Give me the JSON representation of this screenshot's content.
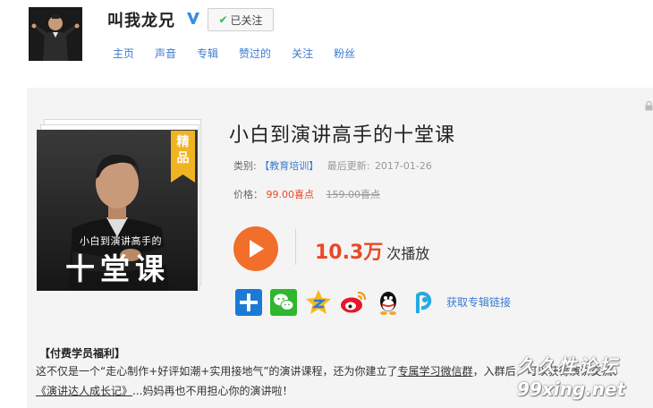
{
  "profile": {
    "username": "叫我龙兄",
    "follow_label": "已关注",
    "verified_icon": "verified-v-icon"
  },
  "nav": {
    "items": [
      "主页",
      "声音",
      "专辑",
      "赞过的",
      "关注",
      "粉丝"
    ]
  },
  "album": {
    "title": "小白到演讲高手的十堂课",
    "category_label": "类别:",
    "category": "【教育培训】",
    "updated_label": "最后更新:",
    "updated": "2017-01-26",
    "price_label": "价格：",
    "price": "99.00喜点",
    "original_price": "159.00喜点",
    "badge": "精品",
    "cover_subtitle": "小白到演讲高手的",
    "cover_title": "十堂课",
    "plays_count": "10.3万",
    "plays_unit": "次播放"
  },
  "share": {
    "icons": [
      "plus-share-icon",
      "wechat-icon",
      "qzone-icon",
      "weibo-icon",
      "qq-icon",
      "pengyou-icon"
    ],
    "link_label": "获取专辑链接"
  },
  "description": {
    "benefit_title": "【付费学员福利】",
    "line1_a": "这不仅是一个“走心制作+好评如潮+实用接地气”的演讲课程，还为你建立了",
    "line1_link": "专属学习微信群",
    "line1_b": "，入群后",
    "line1_c": "，可以",
    "line1_d": "获得",
    "line1_e": "演讲交流、",
    "line2_link": "《演讲达人成长记》",
    "line2_b": "...妈妈再也不用担心你的演讲啦！"
  },
  "watermark": {
    "cn": "久久性论坛",
    "en": "99xing.net"
  },
  "colors": {
    "link": "#3b7bd1",
    "accent": "#e94826",
    "play": "#f26e2b",
    "badge": "#f0b422",
    "panel_bg": "#f4f4f4"
  }
}
